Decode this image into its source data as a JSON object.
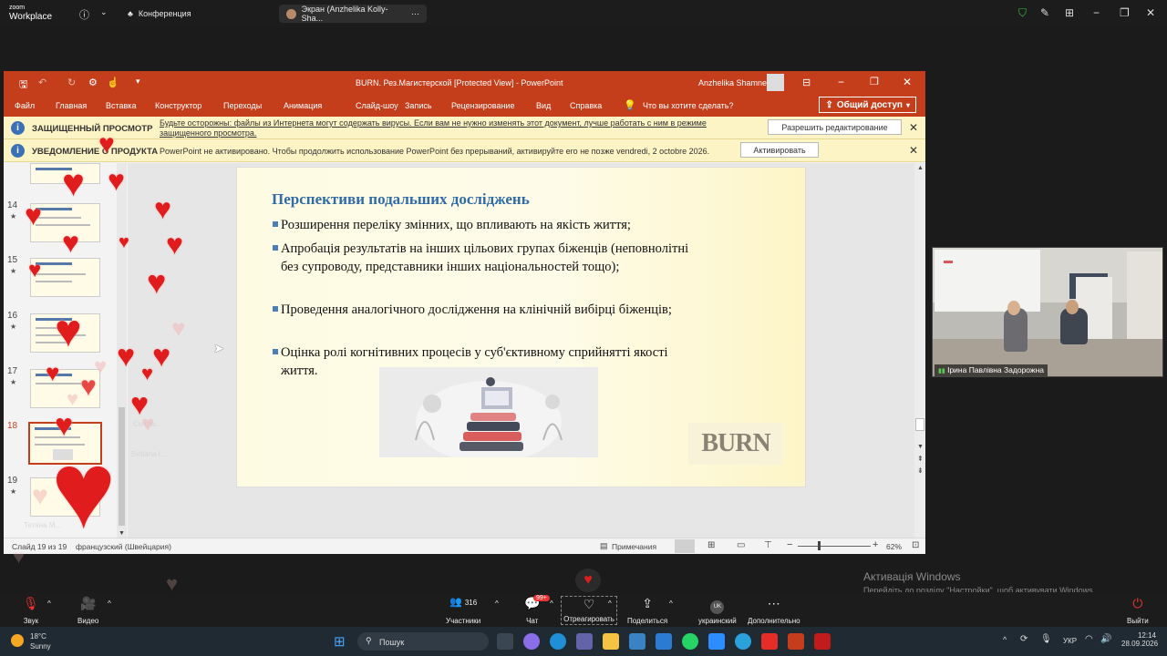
{
  "zoom": {
    "logo_line1": "zoom",
    "logo_line2": "Workplace",
    "tab_conference": "Конференция",
    "tab_share": "Экран (Anzhelika Kolly-Sha...",
    "toolbar": {
      "audio": "Звук",
      "video": "Видео",
      "participants": "Участники",
      "participants_count": "316",
      "chat": "Чат",
      "chat_badge": "99+",
      "react": "Отреагировать",
      "share": "Поделиться",
      "lang_badge": "UK",
      "language": "украинский",
      "more": "Дополнительно",
      "leave": "Выйти"
    },
    "video_tile_name": "Ірина Павлівна Задорожна"
  },
  "ppt": {
    "title": "BURN. Рез.Магистерской [Protected View]  -  PowerPoint",
    "user": "Anzhelika Shamne",
    "ribbon_tabs": [
      "Файл",
      "Главная",
      "Вставка",
      "Конструктор",
      "Переходы",
      "Анимация",
      "Слайд-шоу",
      "Запись",
      "Рецензирование",
      "Вид",
      "Справка"
    ],
    "tell_me": "Что вы хотите сделать?",
    "share": "Общий доступ",
    "protected_bar": {
      "name": "ЗАЩИЩЕННЫЙ ПРОСМОТР",
      "message_line1": "Будьте осторожны: файлы из Интернета могут содержать вирусы. Если вам не нужно изменять этот документ, лучше работать с ним в режиме",
      "message_line2": "защищенного просмотра.",
      "button": "Разрешить редактирование"
    },
    "product_bar": {
      "name": "УВЕДОМЛЕНИЕ О ПРОДУКТА",
      "message": "PowerPoint не активировано. Чтобы продолжить использование PowerPoint без прерываний, активируйте его не позже vendredi, 2 octobre 2026.",
      "button": "Активировать"
    },
    "thumbnails": [
      "14",
      "15",
      "16",
      "17",
      "18",
      "19"
    ],
    "slide": {
      "title": "Перспективи подальших досліджень",
      "bullets": [
        "Розширення переліку змінних, що впливають на якість життя;",
        "Апробація результатів на інших цільових групах біженців (неповнолітні без супроводу, представники інших національностей тощо);",
        "Проведення аналогічного дослідження на клінічній вибірці біженців;",
        "Оцінка ролі когнітивних процесів у суб'єктивному сприйнятті якості життя."
      ],
      "logo": "BURN"
    },
    "status": {
      "slide_of": "Слайд 19 из 19",
      "language": "французский (Швейцария)",
      "notes": "Примечания",
      "zoom": "62%"
    }
  },
  "participant_ghosts": [
    "Svitlana I...",
    "Тетяна М...",
    "Світла..."
  ],
  "windows_activation": {
    "title": "Активація Windows",
    "subtitle": "Перейдіть до розділу \"Настройки\", щоб активувати Windows."
  },
  "taskbar": {
    "temp": "18°C",
    "weather": "Sunny",
    "search": "Пошук",
    "lang": "УКР",
    "time": "12:14",
    "date": "28.09.2026"
  },
  "colors": {
    "ppt_red": "#c43e1c",
    "slide_title": "#2f6ca8",
    "heart": "#e11c1c"
  }
}
